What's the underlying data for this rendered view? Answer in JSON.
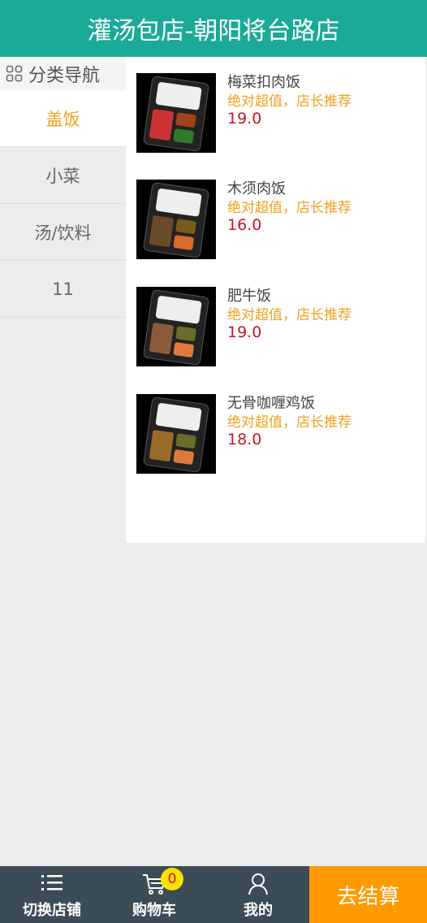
{
  "header": {
    "title": "灌汤包店-朝阳将台路店"
  },
  "sidebar": {
    "title": "分类导航",
    "items": [
      {
        "label": "盖饭",
        "active": true
      },
      {
        "label": "小菜",
        "active": false
      },
      {
        "label": "汤/饮料",
        "active": false
      },
      {
        "label": "11",
        "active": false
      }
    ]
  },
  "products": [
    {
      "name": "梅菜扣肉饭",
      "slogan": "绝对超值，店长推荐",
      "price": "19.0"
    },
    {
      "name": "木须肉饭",
      "slogan": "绝对超值，店长推荐",
      "price": "16.0"
    },
    {
      "name": "肥牛饭",
      "slogan": "绝对超值，店长推荐",
      "price": "19.0"
    },
    {
      "name": "无骨咖喱鸡饭",
      "slogan": "绝对超值，店长推荐",
      "price": "18.0"
    }
  ],
  "footer": {
    "switch_store": "切换店铺",
    "cart": "购物车",
    "cart_count": "0",
    "mine": "我的",
    "checkout": "去结算"
  },
  "colors": {
    "header": "#1aaa97",
    "accent": "#f0a020",
    "price": "#c81623",
    "footer": "#3b4c57",
    "checkout": "#ff9a00"
  }
}
